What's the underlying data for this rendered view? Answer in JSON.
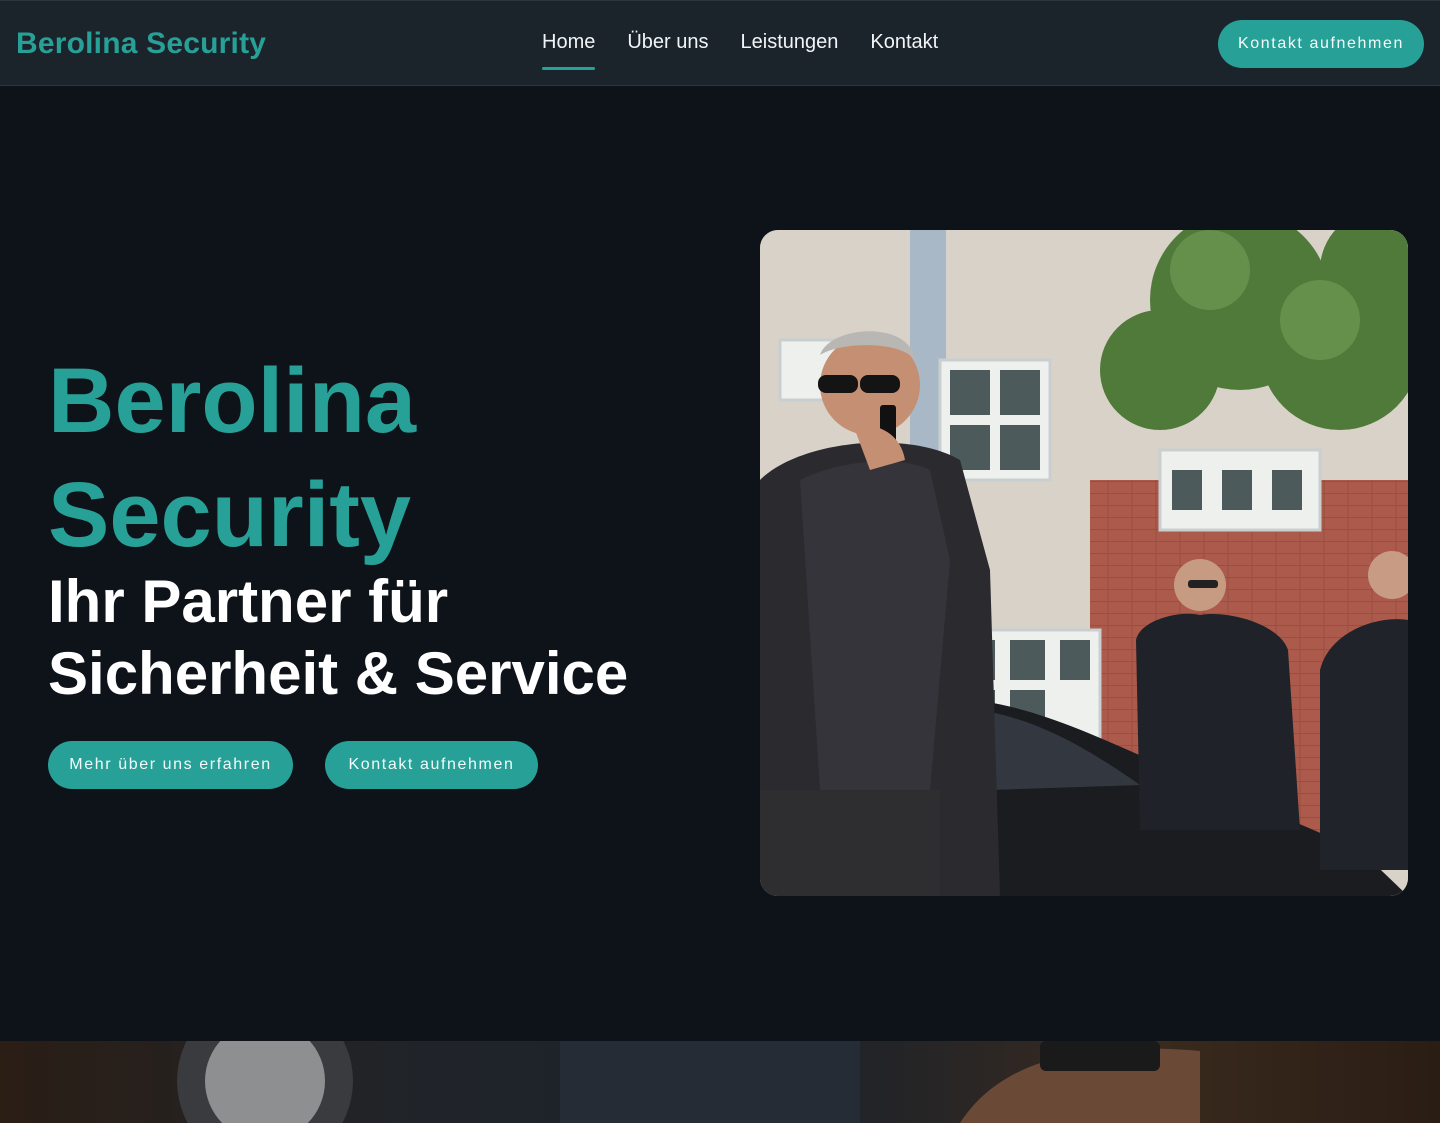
{
  "brand": {
    "name": "Berolina Security",
    "color": "#27a197"
  },
  "nav": {
    "items": [
      {
        "label": "Home",
        "active": true
      },
      {
        "label": "Über uns",
        "active": false
      },
      {
        "label": "Leistungen",
        "active": false
      },
      {
        "label": "Kontakt",
        "active": false
      }
    ],
    "cta_label": "Kontakt aufnehmen"
  },
  "hero": {
    "title_line1": "Berolina",
    "title_line2": "Security",
    "subtitle_line1": "Ihr Partner für",
    "subtitle_line2": "Sicherheit & Service",
    "primary_button": "Mehr über uns erfahren",
    "secondary_button": "Kontakt aufnehmen",
    "image_icon": "security-guards-photo"
  },
  "colors": {
    "background": "#0e131a",
    "navbar": "#1b232b",
    "accent": "#27a197",
    "text": "#ffffff"
  }
}
